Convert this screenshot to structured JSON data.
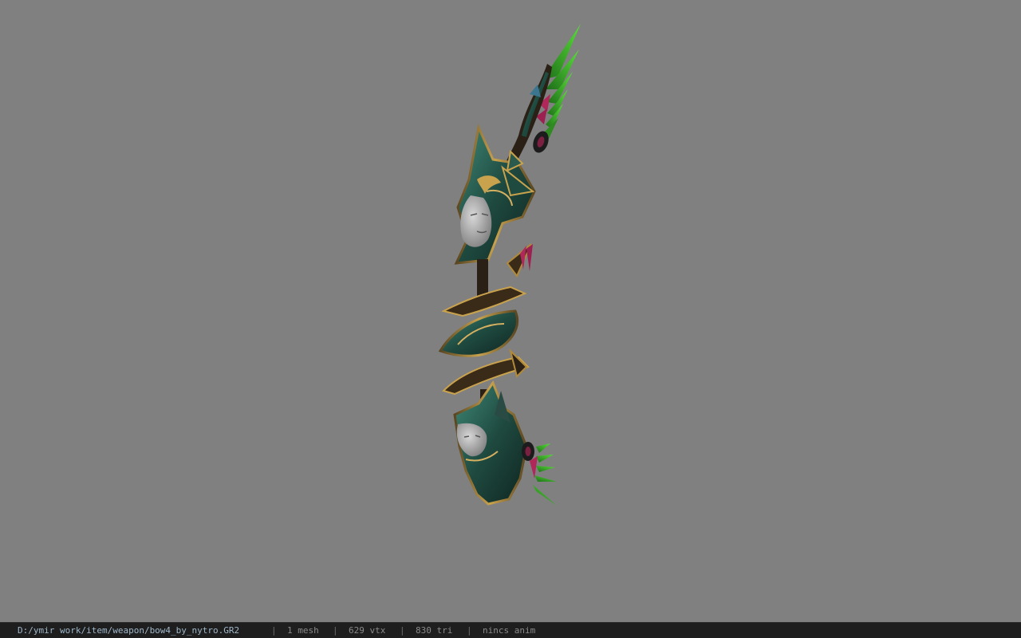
{
  "viewer": {
    "background_color": "#808080",
    "model_name": "bow4_by_nytro"
  },
  "status_bar": {
    "file_path": "D:/ymir work/item/weapon/bow4_by_nytro.GR2",
    "separator": "|",
    "mesh_count": "1 mesh",
    "vertex_count": "629 vtx",
    "triangle_count": "830 tri",
    "animation": "nincs anim"
  }
}
